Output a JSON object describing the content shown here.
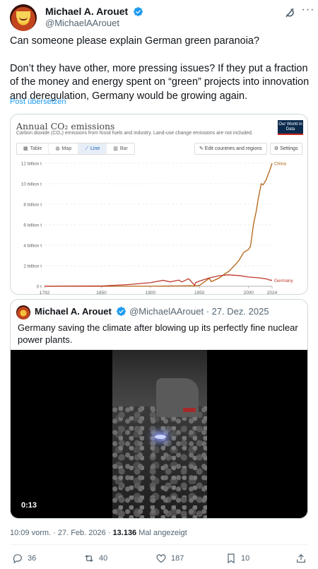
{
  "author": {
    "name": "Michael A. Arouet",
    "handle": "@MichaelAArouet"
  },
  "tweet": {
    "paragraph1": "Can someone please explain German green paranoia?",
    "paragraph2": "Don’t they have other, more pressing issues? If they put a fraction of the money and energy spent on “green” projects into innovation and deregulation, Germany would be growing again.",
    "translate_label": "Post übersetzen"
  },
  "chart_card": {
    "title": "Annual CO₂ emissions",
    "subtitle": "Carbon dioxide (CO₂) emissions from fossil fuels and industry. Land-use change emissions are not included.",
    "logo_text": "Our World in Data",
    "tabs": [
      {
        "label": "Table",
        "icon": "table-icon"
      },
      {
        "label": "Map",
        "icon": "globe-icon"
      },
      {
        "label": "Line",
        "icon": "line-chart-icon"
      },
      {
        "label": "Bar",
        "icon": "bar-chart-icon"
      }
    ],
    "active_tab": "Line",
    "edit_button": "✎ Edit countries and regions",
    "settings_button": "⚙ Settings"
  },
  "chart_data": {
    "type": "line",
    "title": "Annual CO₂ emissions",
    "ylim": [
      0,
      12
    ],
    "xlim": [
      1792,
      2024
    ],
    "y_ticks": [
      "0 t",
      "2 billion t",
      "4 billion t",
      "6 billion t",
      "8 billion t",
      "10 billion t",
      "12 billion t"
    ],
    "x_ticks": [
      "1792",
      "1850",
      "1900",
      "1950",
      "2000",
      "2024"
    ],
    "grid": true,
    "series": [
      {
        "name": "China",
        "color": "#b16214",
        "x": [
          1792,
          1850,
          1900,
          1920,
          1940,
          1945,
          1950,
          1960,
          1962,
          1970,
          1975,
          1980,
          1985,
          1990,
          1995,
          2000,
          2002,
          2005,
          2008,
          2010,
          2013,
          2015,
          2018,
          2020,
          2022,
          2024
        ],
        "y": [
          0,
          0,
          0.01,
          0.02,
          0.05,
          0.03,
          0.08,
          0.78,
          0.45,
          0.8,
          1.15,
          1.47,
          1.95,
          2.48,
          3.3,
          3.6,
          3.9,
          6.0,
          7.4,
          8.6,
          10.0,
          9.9,
          10.4,
          10.9,
          11.4,
          12.0
        ]
      },
      {
        "name": "Germany",
        "color": "#c0392b",
        "x": [
          1792,
          1850,
          1880,
          1900,
          1913,
          1920,
          1929,
          1932,
          1939,
          1945,
          1946,
          1950,
          1960,
          1970,
          1979,
          1990,
          2000,
          2010,
          2019,
          2020,
          2024
        ],
        "y": [
          0,
          0.03,
          0.18,
          0.35,
          0.58,
          0.43,
          0.6,
          0.42,
          0.74,
          0.1,
          0.35,
          0.51,
          0.81,
          1.03,
          1.12,
          1.05,
          0.9,
          0.83,
          0.71,
          0.65,
          0.57
        ]
      }
    ]
  },
  "quote": {
    "name": "Michael A. Arouet",
    "handle": "@MichaelAArouet",
    "date": "· 27. Dez. 2025",
    "text": "Germany saving the climate after blowing up its perfectly fine nuclear power plants.",
    "video_duration": "0:13"
  },
  "meta": {
    "time": "10:09 vorm. · 27. Feb. 2026 · ",
    "views": "13.136",
    "views_label": " Mal angezeigt"
  },
  "actions": {
    "replies": "36",
    "reposts": "40",
    "likes": "187",
    "bookmarks": "10"
  }
}
